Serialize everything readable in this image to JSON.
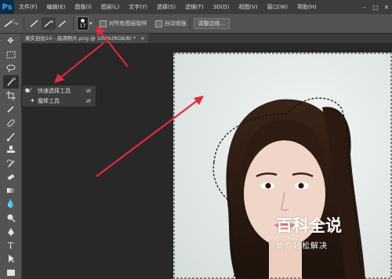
{
  "app": {
    "logo_text": "Ps"
  },
  "menubar": {
    "items": [
      "文件(F)",
      "编辑(E)",
      "图像(I)",
      "图层(L)",
      "文字(Y)",
      "选择(S)",
      "滤镜(T)",
      "3D(D)",
      "视图(V)",
      "窗口(W)",
      "帮助(H)"
    ],
    "window_controls": {
      "minimize": "–",
      "restore": "□",
      "close": "✕"
    }
  },
  "options_bar": {
    "brush_size": "17",
    "sample_all_layers_label": "对所有图层取样",
    "auto_enhance_label": "自动增强",
    "refine_edge_label": "调整边缘..."
  },
  "document": {
    "tab_title": "真实自拍10 - 高清照片.png @ 100%(RGB/8) *",
    "tab_close": "×"
  },
  "flyout": {
    "items": [
      {
        "label": "快速选择工具",
        "shortcut": "W",
        "selected": true
      },
      {
        "label": "魔棒工具",
        "shortcut": "W",
        "selected": false
      }
    ]
  },
  "watermark": {
    "title": "百科全说",
    "subtitle": "助你轻松解决"
  },
  "colors": {
    "arrow": "#e8283a",
    "menubar": "#3c3c3c",
    "toolbar": "#535353",
    "canvas": "#282828",
    "ps_blue": "#31a8ff"
  }
}
